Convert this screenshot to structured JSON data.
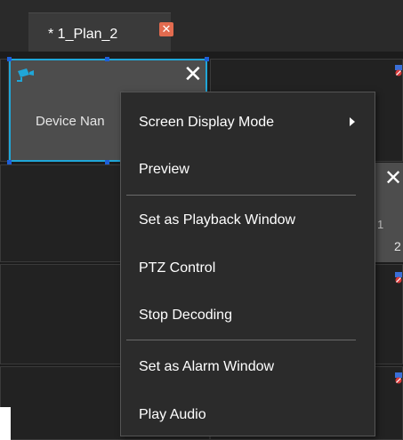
{
  "tab": {
    "title": "* 1_Plan_2",
    "close_glyph": "✕"
  },
  "grid": {
    "selected_cell": {
      "device_label": "Device Nan",
      "close_glyph": "✕",
      "icon": "camera-icon"
    },
    "side_cell": {
      "close_glyph": "✕",
      "num_a": "1",
      "num_b": "2"
    },
    "colors": {
      "accent": "#20a6d8",
      "background": "#1c1c1c",
      "cell": "#4d4d4d"
    }
  },
  "context_menu": {
    "items": [
      {
        "label": "Screen Display Mode",
        "has_submenu": true
      },
      {
        "label": "Preview",
        "has_submenu": false
      },
      {
        "label": "Set as Playback Window",
        "has_submenu": false
      },
      {
        "label": "PTZ Control",
        "has_submenu": false
      },
      {
        "label": "Stop Decoding",
        "has_submenu": false
      },
      {
        "label": "Set as Alarm Window",
        "has_submenu": false
      },
      {
        "label": "Play Audio",
        "has_submenu": false
      }
    ]
  }
}
